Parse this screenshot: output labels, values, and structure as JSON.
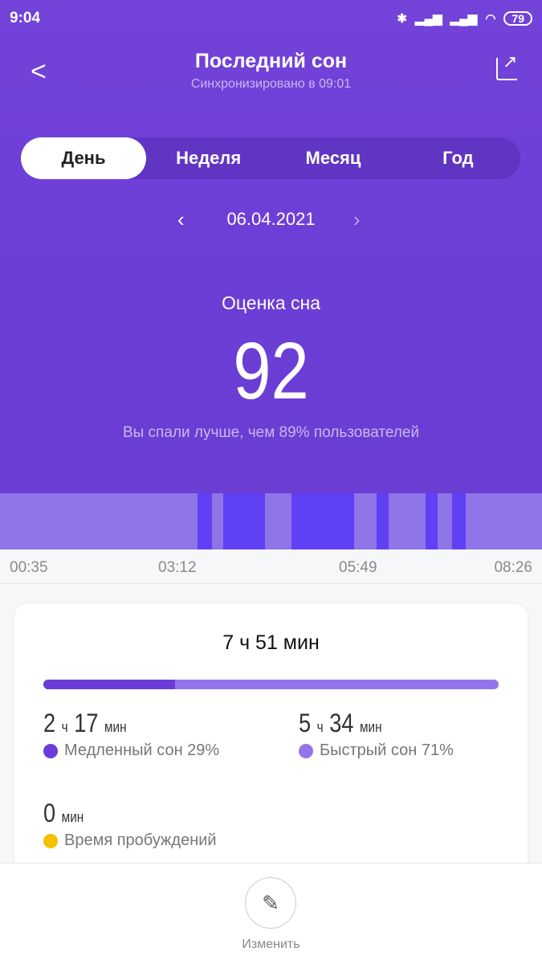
{
  "status": {
    "time": "9:04",
    "battery": "79"
  },
  "header": {
    "title": "Последний сон",
    "subtitle": "Синхронизировано в 09:01"
  },
  "tabs": [
    {
      "label": "День",
      "active": true
    },
    {
      "label": "Неделя"
    },
    {
      "label": "Месяц"
    },
    {
      "label": "Год"
    }
  ],
  "date": "06.04.2021",
  "score": {
    "label": "Оценка сна",
    "value": "92",
    "comparison": "Вы спали лучше, чем 89% пользователей"
  },
  "chart_data": {
    "type": "timeline",
    "start": "00:35",
    "end": "08:26",
    "ticks": [
      "00:35",
      "03:12",
      "05:49",
      "08:26"
    ],
    "colors": {
      "light": "#8f74e8",
      "deep": "#5f40f4"
    },
    "deep_segments": [
      [
        "03:27",
        "03:39"
      ],
      [
        "03:49",
        "04:25"
      ],
      [
        "04:48",
        "05:43"
      ],
      [
        "06:02",
        "06:13"
      ],
      [
        "06:45",
        "06:55"
      ],
      [
        "07:08",
        "07:20"
      ]
    ]
  },
  "summary": {
    "total": "7 ч 51 мин",
    "deep_fraction": 0.29,
    "deep": {
      "h": "2",
      "hu": "ч",
      "m": "17",
      "mu": "мин",
      "label": "Медленный сон 29%",
      "color": "#6a3dd8"
    },
    "light": {
      "h": "5",
      "hu": "ч",
      "m": "34",
      "mu": "мин",
      "label": "Быстрый сон 71%",
      "color": "#9374ea"
    },
    "awake": {
      "m": "0",
      "mu": "мин",
      "label": "Время пробуждений",
      "color": "#f5c000"
    }
  },
  "footer": {
    "edit": "Изменить"
  }
}
